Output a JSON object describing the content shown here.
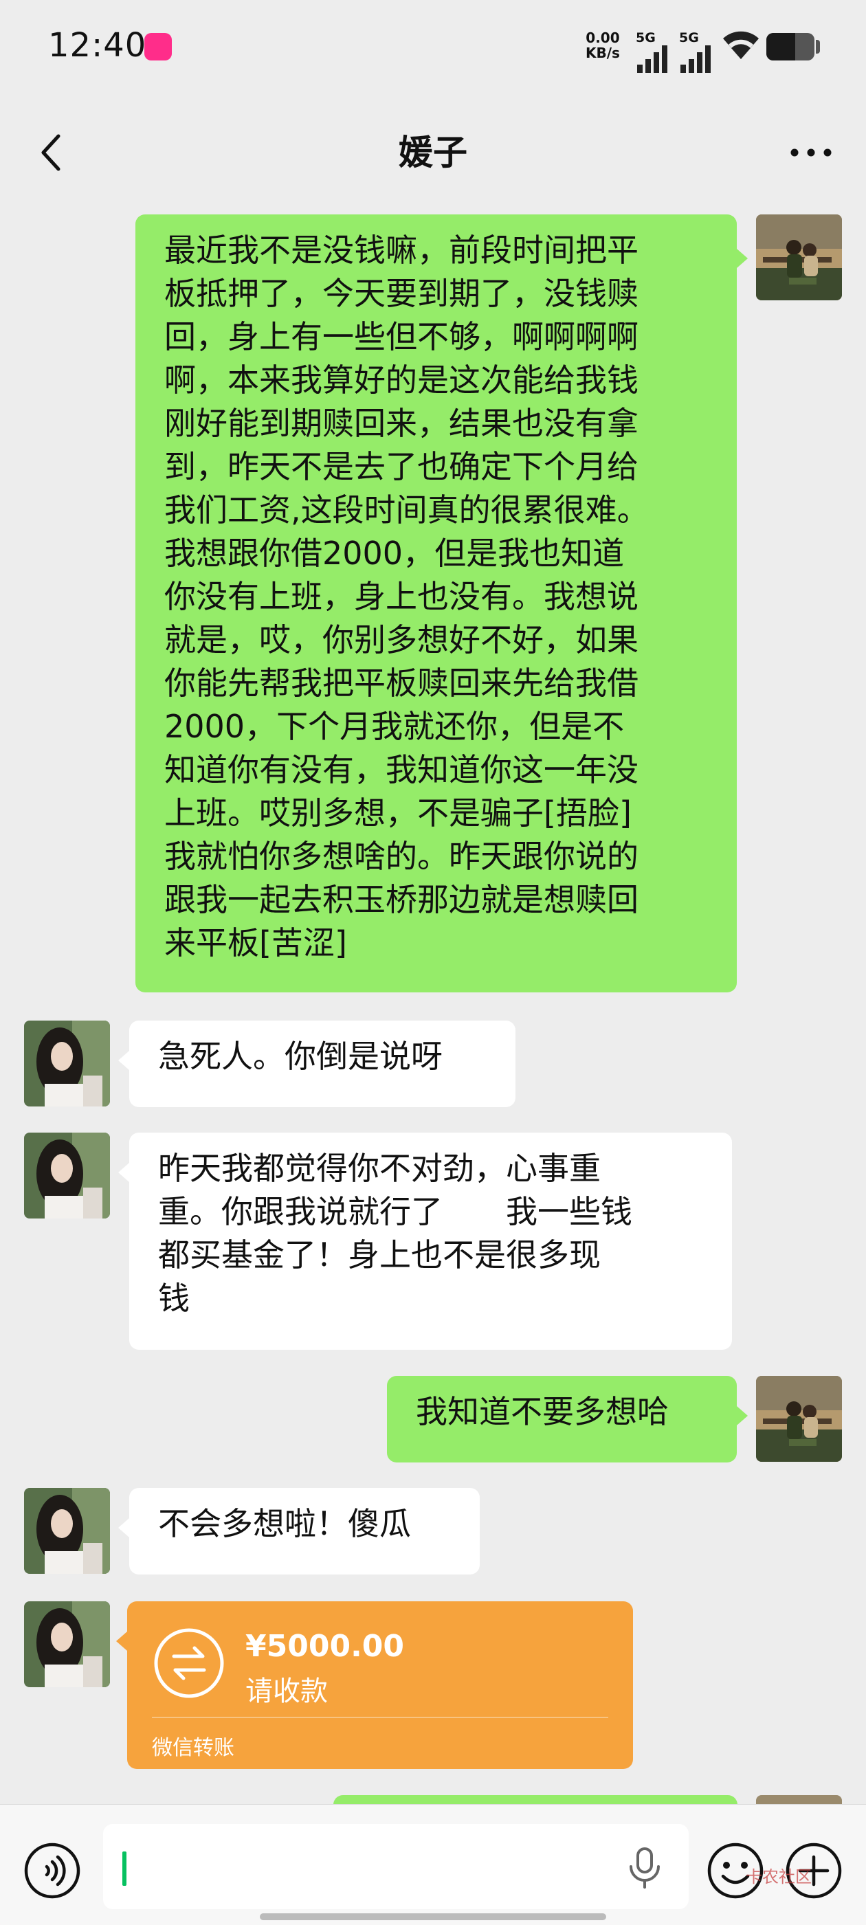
{
  "status_bar": {
    "time": "12:40",
    "net_speed_value": "0.00",
    "net_speed_unit": "KB/s",
    "sim1": "5G",
    "sim2": "5G",
    "battery_level": 0.6
  },
  "header": {
    "title": "媛子",
    "back_icon": "chevron-left-icon",
    "more_icon": "more-dots-icon"
  },
  "messages": [
    {
      "from": "me",
      "type": "text",
      "text": "最近我不是没钱嘛，前段时间把平\n板抵押了，今天要到期了，没钱赎\n回，身上有一些但不够，啊啊啊啊\n啊，本来我算好的是这次能给我钱\n刚好能到期赎回来，结果也没有拿\n到，昨天不是去了也确定下个月给\n我们工资,这段时间真的很累很难。\n我想跟你借2000，但是我也知道\n你没有上班，身上也没有。我想说\n就是，哎，你别多想好不好，如果\n你能先帮我把平板赎回来先给我借\n2000，下个月我就还你，但是不\n知道你有没有，我知道你这一年没\n上班。哎别多想，不是骗子[捂脸]\n我就怕你多想啥的。昨天跟你说的\n跟我一起去积玉桥那边就是想赎回\n来平板[苦涩]"
    },
    {
      "from": "her",
      "type": "text",
      "text": "急死人。你倒是说呀"
    },
    {
      "from": "her",
      "type": "text",
      "text": "昨天我都觉得你不对劲，心事重\n重。你跟我说就行了　　我一些钱\n都买基金了！身上也不是很多现\n钱"
    },
    {
      "from": "me",
      "type": "text",
      "text": "我知道不要多想哈"
    },
    {
      "from": "her",
      "type": "text",
      "text": "不会多想啦！傻瓜"
    },
    {
      "from": "her",
      "type": "transfer",
      "amount": "¥5000.00",
      "status": "请收款",
      "source": "微信转账"
    }
  ],
  "input_bar": {
    "voice_icon": "voice-icon",
    "mic_icon": "microphone-icon",
    "emoji_icon": "emoji-icon",
    "plus_icon": "plus-icon"
  },
  "watermark": "卡农社区",
  "colors": {
    "background": "#ededed",
    "my_bubble": "#95ec69",
    "their_bubble": "#ffffff",
    "transfer_card": "#f6a33d",
    "caret": "#07c160"
  }
}
